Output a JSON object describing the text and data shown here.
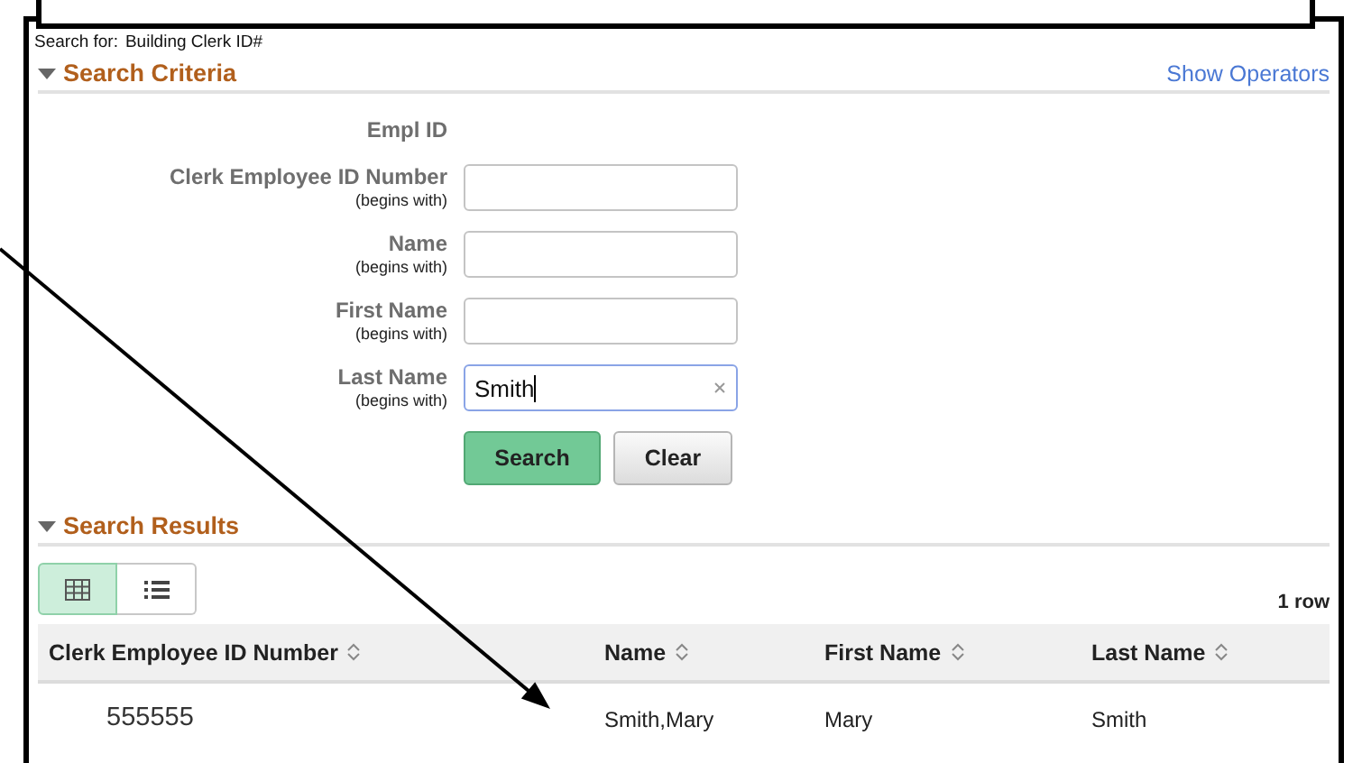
{
  "search_for": {
    "label": "Search for:",
    "value": "Building Clerk ID#"
  },
  "search_criteria": {
    "title": "Search Criteria",
    "expanded": true,
    "link": "Show Operators",
    "fields": [
      {
        "kind": "static",
        "label": "Empl ID"
      },
      {
        "kind": "text",
        "label": "Clerk Employee ID Number",
        "hint": "(begins with)",
        "focused": false
      },
      {
        "kind": "text",
        "label": "Name",
        "hint": "(begins with)",
        "focused": false
      },
      {
        "kind": "text",
        "label": "First Name",
        "hint": "(begins with)",
        "focused": false
      },
      {
        "kind": "text",
        "label": "Last Name",
        "hint": "(begins with)",
        "value": "Smith",
        "focused": true
      }
    ],
    "buttons": [
      {
        "label": "Search",
        "primary": true
      },
      {
        "label": "Clear",
        "primary": false
      }
    ]
  },
  "search_results": {
    "title": "Search Results",
    "expanded": true,
    "views": [
      {
        "kind": "grid",
        "selected": true
      },
      {
        "kind": "list",
        "selected": false
      }
    ],
    "row_count": "1 row",
    "table": {
      "columns": [
        "Clerk Employee ID Number",
        "Name",
        "First Name",
        "Last Name"
      ],
      "rows": [
        [
          "555555",
          "Smith,Mary",
          "Mary",
          "Smith"
        ]
      ]
    }
  }
}
